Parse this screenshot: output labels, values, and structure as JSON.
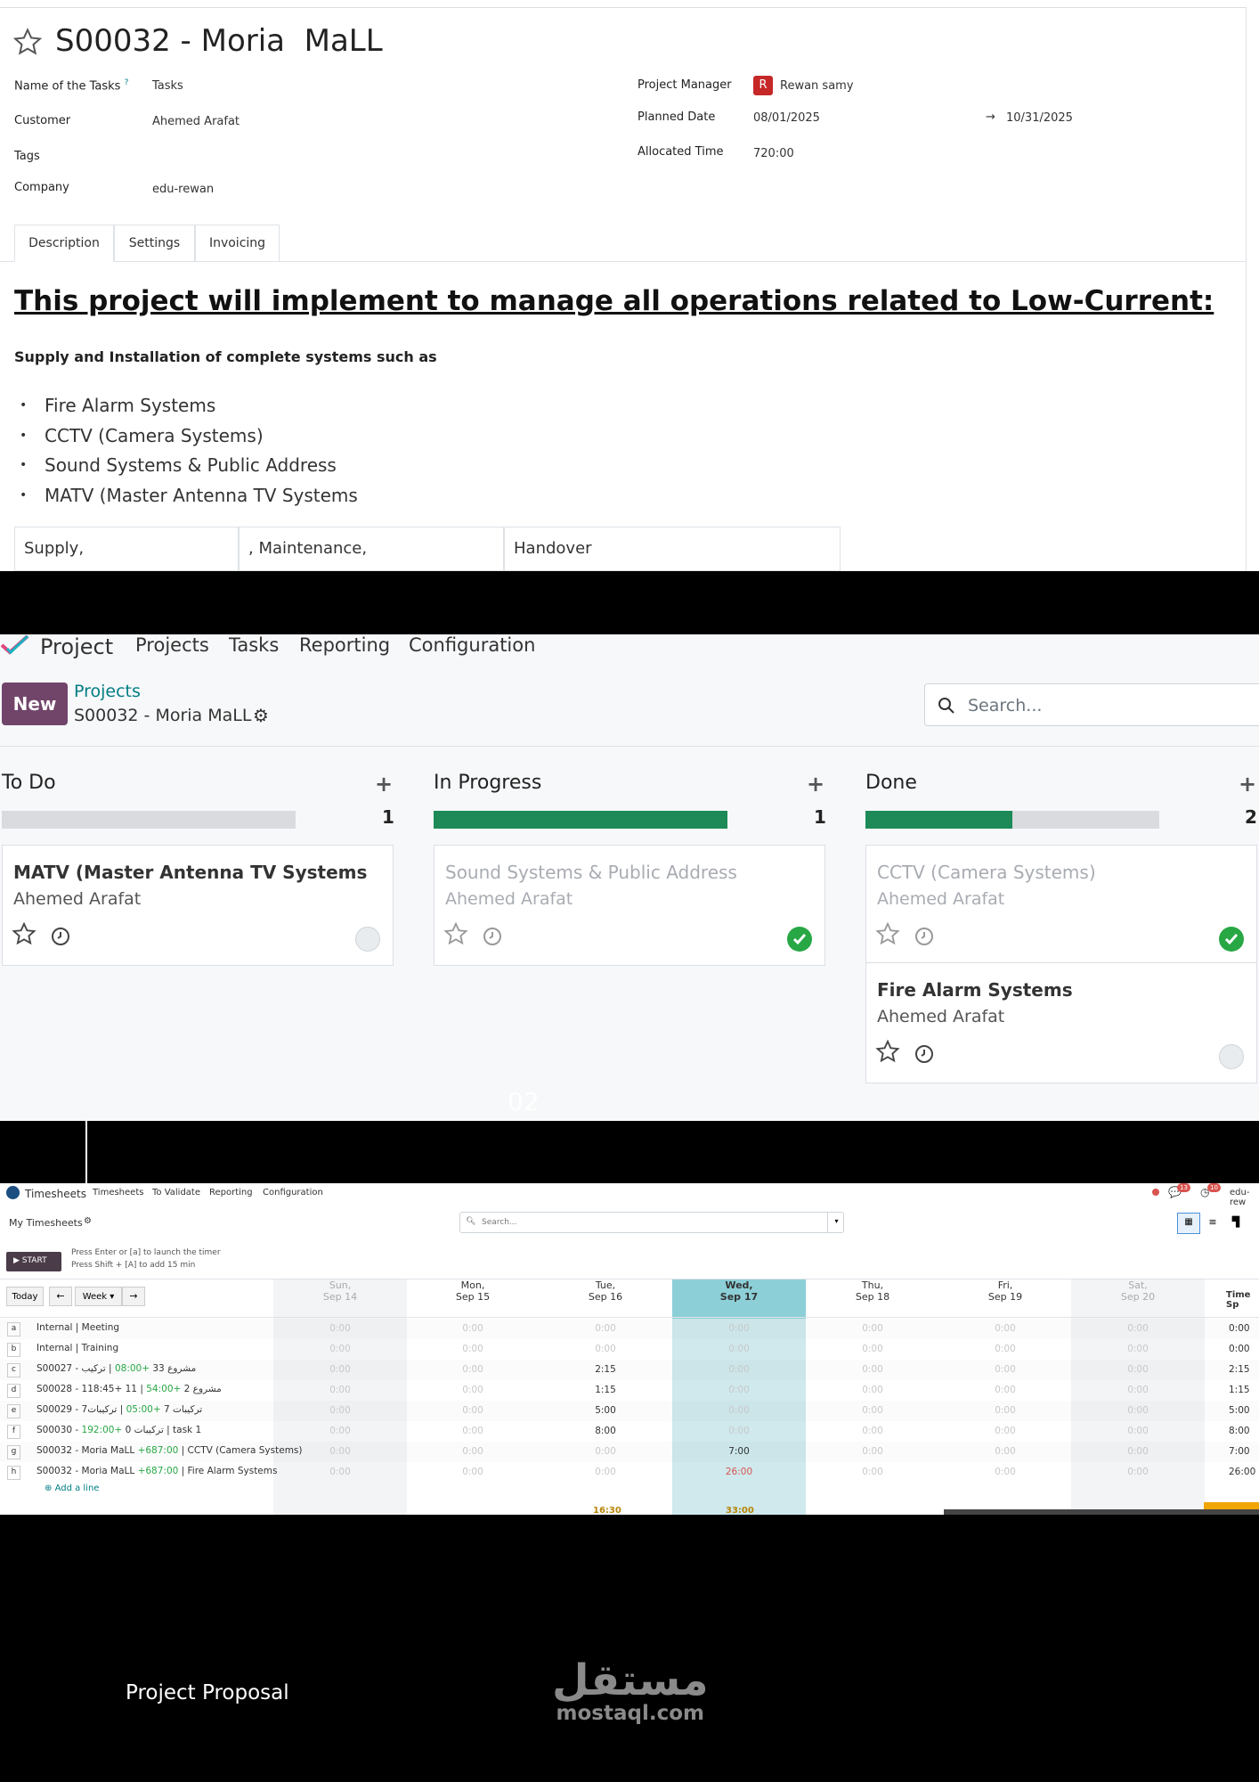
{
  "form": {
    "title": "S00032 - Moria  MaLL",
    "fields_left": [
      {
        "label": "Name of the Tasks",
        "help": "?",
        "value": "Tasks"
      },
      {
        "label": "Customer",
        "value": "Ahemed Arafat"
      },
      {
        "label": "Tags",
        "value": ""
      },
      {
        "label": "Company",
        "value": "edu-rewan"
      }
    ],
    "fields_right": [
      {
        "label": "Project Manager",
        "value": "Rewan samy",
        "avatar": "R"
      },
      {
        "label": "Planned Date",
        "value": "08/01/2025",
        "value_end": "10/31/2025"
      },
      {
        "label": "Allocated Time",
        "value": "720:00"
      }
    ],
    "tabs": [
      "Description",
      "Settings",
      "Invoicing"
    ],
    "heading": "This project will implement to manage all operations related to Low-Current:",
    "subheading": "Supply and Installation of complete systems such as",
    "bullets": [
      "Fire Alarm Systems",
      "CCTV (Camera Systems)",
      "Sound Systems & Public Address",
      "MATV (Master Antenna TV Systems"
    ],
    "table": [
      "Supply,",
      ", Maintenance,",
      "Handover"
    ],
    "accent": "#017e84"
  },
  "kanban": {
    "app": "Project",
    "menu": [
      "Projects",
      "Tasks",
      "Reporting",
      "Configuration"
    ],
    "new_label": "New",
    "breadcrumb": "Projects",
    "current": "S00032 - Moria MaLL",
    "search_placeholder": "Search...",
    "columns": [
      {
        "title": "To Do",
        "count": "1",
        "progress": 0,
        "cards": [
          {
            "title": "MATV (Master Antenna TV Systems",
            "customer": "Ahemed Arafat",
            "state": "grey"
          }
        ]
      },
      {
        "title": "In Progress",
        "count": "1",
        "progress": 1,
        "cards": [
          {
            "title": "Sound Systems & Public Address",
            "customer": "Ahemed Arafat",
            "state": "green"
          }
        ]
      },
      {
        "title": "Done",
        "count": "2",
        "progress": 0.5,
        "cards": [
          {
            "title": "CCTV (Camera Systems)",
            "customer": "Ahemed Arafat",
            "state": "green"
          },
          {
            "title": "Fire Alarm Systems",
            "customer": "Ahemed Arafat",
            "state": "grey"
          }
        ]
      }
    ],
    "page_mark": "02",
    "brand_color": "#71456a",
    "progress_color": "#1d8a57"
  },
  "timesheets": {
    "app": "Timesheets",
    "menu": [
      "Timesheets",
      "To Validate",
      "Reporting",
      "Configuration"
    ],
    "badges": [
      "13",
      "10"
    ],
    "user": "edu-rew",
    "view_title": "My Timesheets",
    "search_placeholder": "Search...",
    "start_label": "START",
    "hint1": "Press Enter or [a] to launch the timer",
    "hint2": "Press Shift + [A] to add 15 min",
    "today": "Today",
    "week": "Week",
    "days": [
      {
        "d": "Sun,",
        "date": "Sep 14"
      },
      {
        "d": "Mon,",
        "date": "Sep 15"
      },
      {
        "d": "Tue,",
        "date": "Sep 16"
      },
      {
        "d": "Wed,",
        "date": "Sep 17"
      },
      {
        "d": "Thu,",
        "date": "Sep 18"
      },
      {
        "d": "Fri,",
        "date": "Sep 19"
      },
      {
        "d": "Sat,",
        "date": "Sep 20"
      }
    ],
    "total_header": "Time Sp",
    "rows": [
      {
        "key": "a",
        "label": "Internal  |  Meeting",
        "extra": "",
        "cells": [
          "0:00",
          "0:00",
          "0:00",
          "0:00",
          "0:00",
          "0:00",
          "0:00"
        ],
        "total": "0:00"
      },
      {
        "key": "b",
        "label": "Internal  |  Training",
        "extra": "",
        "cells": [
          "0:00",
          "0:00",
          "0:00",
          "0:00",
          "0:00",
          "0:00",
          "0:00"
        ],
        "total": "0:00"
      },
      {
        "key": "c",
        "label": "S00027 - مشروع 33",
        "extra": "+08:00",
        "suffix": "|  تركيب",
        "cells": [
          "0:00",
          "0:00",
          "2:15",
          "0:00",
          "0:00",
          "0:00",
          "0:00"
        ],
        "total": "2:15"
      },
      {
        "key": "d",
        "label": "S00028 - مشروع 2",
        "extra": "+54:00",
        "suffix": "|  11  +118:45",
        "cells": [
          "0:00",
          "0:00",
          "1:15",
          "0:00",
          "0:00",
          "0:00",
          "0:00"
        ],
        "total": "1:15"
      },
      {
        "key": "e",
        "label": "S00029 - تركيبات 7",
        "extra": "+05:00",
        "suffix": "|  تركيبات7",
        "cells": [
          "0:00",
          "0:00",
          "5:00",
          "0:00",
          "0:00",
          "0:00",
          "0:00"
        ],
        "total": "5:00"
      },
      {
        "key": "f",
        "label": "S00030 - تركيبات 0",
        "extra": "+192:00",
        "suffix": "|  task 1",
        "cells": [
          "0:00",
          "0:00",
          "8:00",
          "0:00",
          "0:00",
          "0:00",
          "0:00"
        ],
        "total": "8:00"
      },
      {
        "key": "g",
        "label": "S00032 - Moria MaLL",
        "extra": "+687:00",
        "suffix": "|  CCTV (Camera Systems)",
        "cells": [
          "0:00",
          "0:00",
          "0:00",
          "7:00",
          "0:00",
          "0:00",
          "0:00"
        ],
        "total": "7:00"
      },
      {
        "key": "h",
        "label": "S00032 - Moria MaLL",
        "extra": "+687:00",
        "suffix": "|  Fire Alarm Systems",
        "cells": [
          "0:00",
          "0:00",
          "0:00",
          "26:00",
          "0:00",
          "0:00",
          "0:00"
        ],
        "total": "26:00"
      }
    ],
    "add_line": "Add a line",
    "totals": {
      "tue": "16:30",
      "wed": "33:00"
    }
  },
  "footer": {
    "left": "Project Proposal",
    "logo_ar": "مستقل",
    "logo_en": "mostaql.com"
  }
}
